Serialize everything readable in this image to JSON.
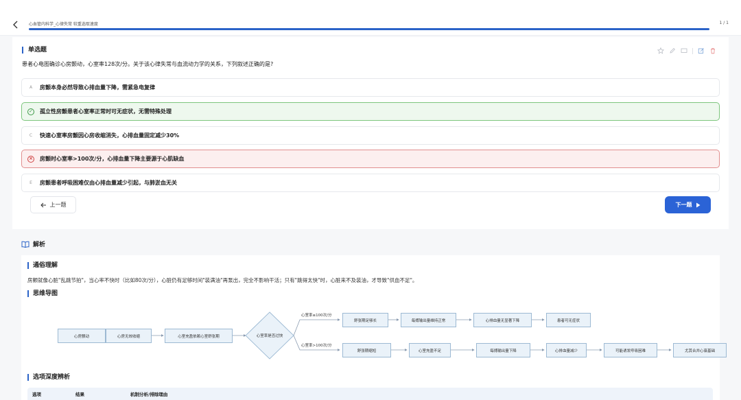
{
  "header": {
    "back_icon": "chevron-left-icon",
    "breadcrumb": "心血管内科学_心律失常 较重选取速度",
    "page_count": "1 / 1",
    "progress": 1.0,
    "accent": "#2b63c8"
  },
  "question": {
    "type_label": "单选题",
    "text": "患者心电图确诊心房颤动，心室率128次/分。关于该心律失常与血流动力学的关系，下列叙述正确的是?",
    "tools": [
      "star-icon",
      "pencil-icon",
      "screen-icon",
      "edit-icon",
      "trash-icon"
    ],
    "options": [
      {
        "letter": "A",
        "text": "房颤本身必然导致心排血量下降，需紧急电复律",
        "state": "normal"
      },
      {
        "letter": "B",
        "text": "孤立性房颤患者心室率正常时可无症状，无需特殊处理",
        "state": "correct"
      },
      {
        "letter": "C",
        "text": "快速心室率房颤因心房收缩消失，心排血量固定减少30%",
        "state": "normal"
      },
      {
        "letter": "D",
        "text": "房颤时心室率>100次/分，心排血量下降主要源于心肌缺血",
        "state": "wrong"
      },
      {
        "letter": "E",
        "text": "房颤患者呼吸困难仅由心排血量减少引起，与肺淤血无关",
        "state": "normal"
      }
    ],
    "correct_color": "#3e9a48",
    "wrong_color": "#d04545"
  },
  "nav": {
    "prev_label": "上一题",
    "next_label": "下一题"
  },
  "analysis": {
    "title": "解析",
    "plain_title": "通俗理解",
    "plain_text": "房颤就像心脏\"乱跳节拍\"，当心率不快时（比如80次/分），心脏仍有足够时间\"装满油\"再泵出，完全不影响干活；只有\"跳得太快\"时，心脏来不及装油，才导致\"供血不足\"。",
    "mindmap_title": "思维导图",
    "mindmap": {
      "start_nodes": [
        "心房颤动",
        "心房无效收缩",
        "心室充盈依赖心室舒张期"
      ],
      "decision": "心室率是否过快",
      "upper_label": "心室率≤100次/分",
      "lower_label": "心室率>100次/分",
      "upper_nodes": [
        "舒张期足够长",
        "每搏输出量维持正常",
        "心排血量无显著下降",
        "患者可无症状"
      ],
      "lower_nodes": [
        "舒张期缩短",
        "心室充盈不足",
        "每搏输出量下降",
        "心排血量减少",
        "可能诱发呼吸困难",
        "尤其合并心衰基础"
      ]
    },
    "deep_title": "选项深度辨析",
    "table_headers": [
      "选项",
      "结果",
      "机制分析/排除理由"
    ]
  }
}
